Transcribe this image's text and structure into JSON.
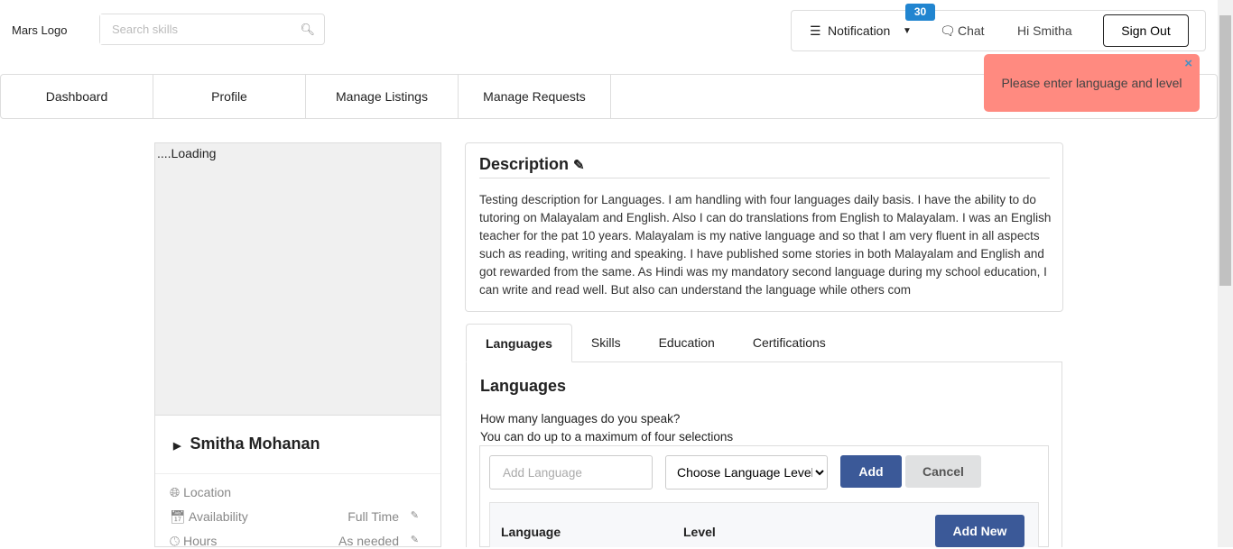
{
  "header": {
    "logo": "Mars Logo",
    "search_placeholder": "Search skills",
    "notification": "Notification",
    "notification_count": "30",
    "chat": "Chat",
    "greeting": "Hi Smitha",
    "sign_out": "Sign Out"
  },
  "nav": [
    "Dashboard",
    "Profile",
    "Manage Listings",
    "Manage Requests"
  ],
  "toast": {
    "message": "Please enter language and level",
    "close": "×"
  },
  "profile": {
    "photo_alt": "....Loading",
    "name": "Smitha Mohanan",
    "location_label": "Location",
    "availability_label": "Availability",
    "availability_value": "Full Time",
    "hours_label": "Hours",
    "hours_value": "As needed"
  },
  "description": {
    "title": "Description",
    "text": "Testing description for Languages. I am handling with four languages daily basis. I have the ability to do tutoring on Malayalam and English. Also I can do translations from English to Malayalam. I was an English teacher for the pat 10 years. Malayalam is my native language and so that I am very fluent in all aspects such as reading, writing and speaking. I have published some stories in both Malayalam and English and got rewarded from the same. As Hindi was my mandatory second language during my school education, I can write and read well. But also can understand the language while others com"
  },
  "tabs": [
    "Languages",
    "Skills",
    "Education",
    "Certifications"
  ],
  "languages": {
    "title": "Languages",
    "question": "How many languages do you speak?",
    "hint": "You can do up to a maximum of four selections",
    "input_placeholder": "Add Language",
    "level_selected": "Choose Language Level",
    "add": "Add",
    "cancel": "Cancel",
    "col_language": "Language",
    "col_level": "Level",
    "add_new": "Add New"
  }
}
